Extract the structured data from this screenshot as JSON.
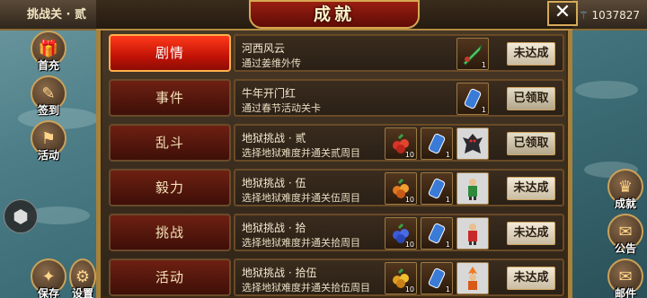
{
  "stage": {
    "label": "挑战关 · 贰"
  },
  "currency": {
    "value": "1037827"
  },
  "left_menu": [
    {
      "label": "首充",
      "icon": "gift-icon"
    },
    {
      "label": "签到",
      "icon": "calendar-icon"
    },
    {
      "label": "活动",
      "icon": "flag-icon"
    },
    {
      "label": "保存",
      "icon": "save-icon"
    },
    {
      "label": "设置",
      "icon": "gear-icon"
    }
  ],
  "right_menu": [
    {
      "label": "成就",
      "icon": "trophy-icon"
    },
    {
      "label": "公告",
      "icon": "scroll-icon"
    },
    {
      "label": "邮件",
      "icon": "mail-icon"
    }
  ],
  "dialog": {
    "title": "成就",
    "close_symbol": "✕"
  },
  "tabs": [
    {
      "label": "剧情",
      "active": true
    },
    {
      "label": "事件",
      "active": false
    },
    {
      "label": "乱斗",
      "active": false
    },
    {
      "label": "毅力",
      "active": false
    },
    {
      "label": "挑战",
      "active": false
    },
    {
      "label": "活动",
      "active": false
    }
  ],
  "achievements": [
    {
      "title": "河西风云",
      "desc": "通过姜维外传",
      "status": "未达成",
      "rewards": [
        {
          "icon": "jade-weapon-icon",
          "count": "1"
        }
      ]
    },
    {
      "title": "牛年开门红",
      "desc": "通过春节活动关卡",
      "status": "已领取",
      "rewards": [
        {
          "icon": "blue-gem-icon",
          "count": "1"
        }
      ]
    },
    {
      "title": "地狱挑战 · 贰",
      "desc": "选择地狱难度并通关贰周目",
      "status": "已领取",
      "rewards": [
        {
          "icon": "fruit-icon",
          "count": "10"
        },
        {
          "icon": "blue-gem-icon",
          "count": "1"
        },
        {
          "icon": "demon-portrait-icon",
          "count": ""
        }
      ]
    },
    {
      "title": "地狱挑战 · 伍",
      "desc": "选择地狱难度并通关伍周目",
      "status": "未达成",
      "rewards": [
        {
          "icon": "fruit-icon",
          "count": "10"
        },
        {
          "icon": "blue-gem-icon",
          "count": "1"
        },
        {
          "icon": "green-warrior-portrait-icon",
          "count": ""
        }
      ]
    },
    {
      "title": "地狱挑战 · 拾",
      "desc": "选择地狱难度并通关拾周目",
      "status": "未达成",
      "rewards": [
        {
          "icon": "fruit-icon",
          "count": "10"
        },
        {
          "icon": "blue-gem-icon",
          "count": "1"
        },
        {
          "icon": "red-warrior-portrait-icon",
          "count": ""
        }
      ]
    },
    {
      "title": "地狱挑战 · 拾伍",
      "desc": "选择地狱难度并通关拾伍周目",
      "status": "未达成",
      "rewards": [
        {
          "icon": "fruit-icon",
          "count": "10"
        },
        {
          "icon": "blue-gem-icon",
          "count": "1"
        },
        {
          "icon": "fire-warrior-portrait-icon",
          "count": ""
        }
      ]
    }
  ],
  "colors": {
    "tab_active": "#e52a12",
    "tab": "#5a170c",
    "panel_gold": "#a8813a"
  }
}
